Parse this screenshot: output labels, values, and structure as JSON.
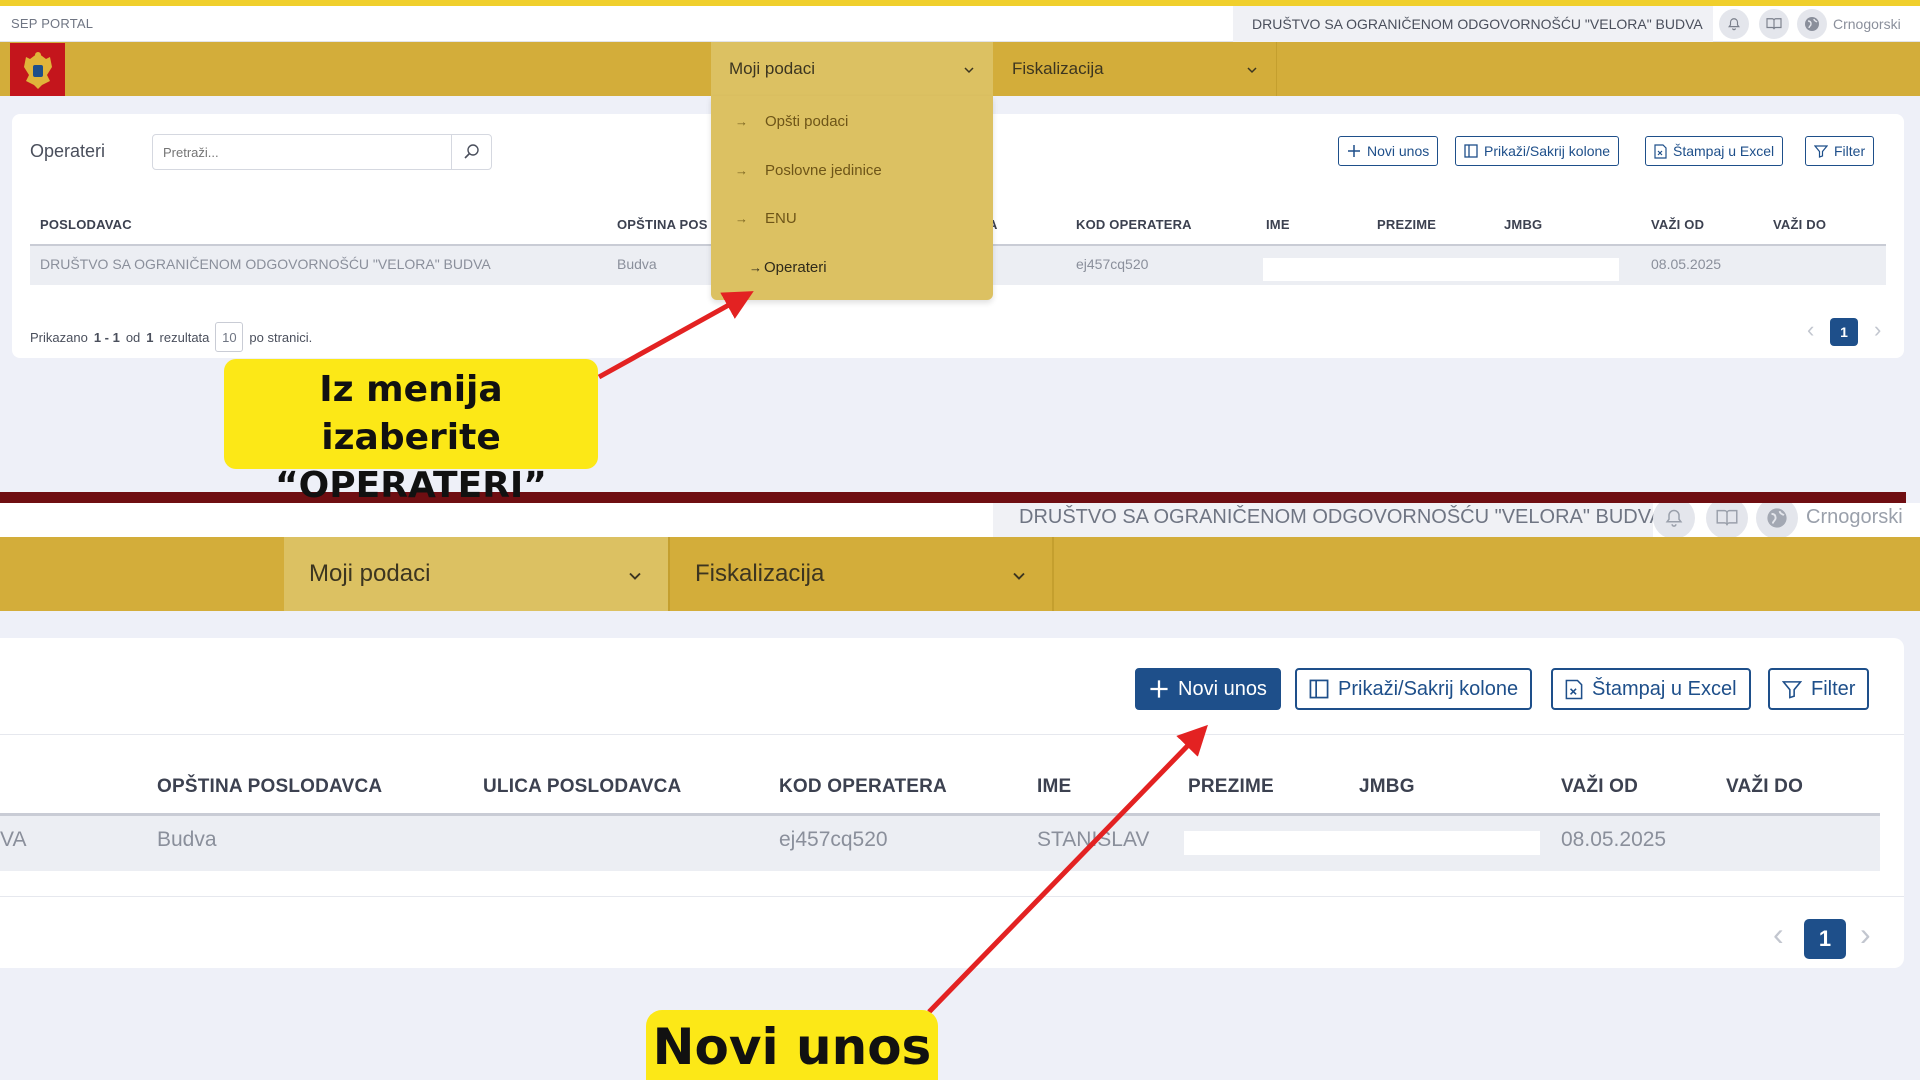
{
  "top": {
    "portal_name": "SEP PORTAL",
    "company": "DRUŠTVO SA OGRANIČENOM ODGOVORNOŠĆU \"VELORA\" BUDVA",
    "language": "Crnogorski",
    "nav": {
      "moji_podaci": "Moji podaci",
      "fiskalizacija": "Fiskalizacija"
    },
    "dropdown": [
      "Opšti podaci",
      "Poslovne jedinice",
      "ENU",
      "Operateri"
    ],
    "page_title": "Operateri",
    "search_placeholder": "Pretraži...",
    "toolbar": {
      "new": "Novi unos",
      "columns": "Prikaži/Sakrij kolone",
      "excel": "Štampaj u Excel",
      "filter": "Filter"
    },
    "columns": [
      "POSLODAVAC",
      "OPŠTINA POS",
      "A",
      "KOD OPERATERA",
      "IME",
      "PREZIME",
      "JMBG",
      "VAŽI OD",
      "VAŽI DO"
    ],
    "row": {
      "poslodavac": "DRUŠTVO SA OGRANIČENOM ODGOVORNOŠĆU \"VELORA\" BUDVA",
      "opstina": "Budva",
      "kod": "ej457cq520",
      "vazi_od": "08.05.2025"
    },
    "footer": {
      "prefix": "Prikazano",
      "range": "1 - 1",
      "od": "od",
      "total": "1",
      "suffix": "rezultata",
      "per_page": "10",
      "per_page_label": "po stranici."
    },
    "page": "1"
  },
  "bottom": {
    "company": "DRUŠTVO SA OGRANIČENOM ODGOVORNOŠĆU \"VELORA\" BUDVA",
    "language": "Crnogorski",
    "nav": {
      "moji_podaci": "Moji podaci",
      "fiskalizacija": "Fiskalizacija"
    },
    "toolbar": {
      "new": "Novi unos",
      "columns": "Prikaži/Sakrij kolone",
      "excel": "Štampaj u Excel",
      "filter": "Filter"
    },
    "columns": [
      "OPŠTINA POSLODAVCA",
      "ULICA POSLODAVCA",
      "KOD OPERATERA",
      "IME",
      "PREZIME",
      "JMBG",
      "VAŽI OD",
      "VAŽI DO"
    ],
    "row": {
      "poslodavac_tail": "VA",
      "opstina": "Budva",
      "kod": "ej457cq520",
      "ime": "STANISLAV",
      "vazi_od": "08.05.2025"
    },
    "page": "1"
  },
  "annotations": {
    "step1_line1": "Iz menija izaberite",
    "step1_line2": "“OPERATERI”",
    "step2": "Novi unos"
  },
  "colors": {
    "nav_gold": "#d3ad3a",
    "accent_blue": "#1e4f8a",
    "callout_yellow": "#fce817",
    "arrow_red": "#e32222",
    "divider": "#6f0e12"
  }
}
